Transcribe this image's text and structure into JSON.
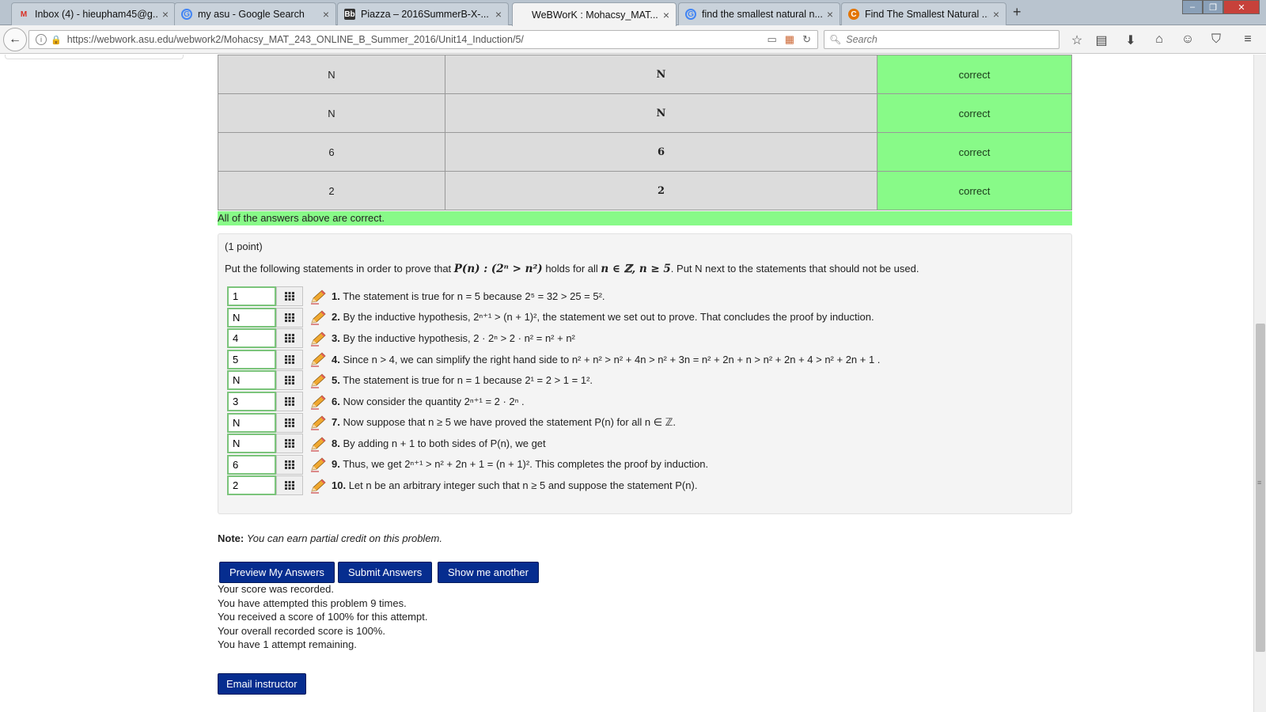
{
  "browser": {
    "tabs": [
      {
        "title": "Inbox (4) - hieupham45@g...",
        "icon": "gmail-icon"
      },
      {
        "title": "my asu - Google Search",
        "icon": "google-icon"
      },
      {
        "title": "Piazza – 2016SummerB-X-...",
        "icon": "blackboard-icon"
      },
      {
        "title": "WeBWorK : Mohacsy_MAT...",
        "icon": "webwork-icon"
      },
      {
        "title": "find the smallest natural n...",
        "icon": "google-icon"
      },
      {
        "title": "Find The Smallest Natural ...",
        "icon": "chegg-icon"
      }
    ],
    "url": "https://webwork.asu.edu/webwork2/Mohacsy_MAT_243_ONLINE_B_Summer_2016/Unit14_Induction/5/",
    "search_placeholder": "Search"
  },
  "attempt_results": {
    "rows": [
      {
        "entered": "N",
        "preview": "N",
        "result": "correct"
      },
      {
        "entered": "N",
        "preview": "N",
        "result": "correct"
      },
      {
        "entered": "6",
        "preview": "6",
        "result": "correct"
      },
      {
        "entered": "2",
        "preview": "2",
        "result": "correct"
      }
    ],
    "summary": "All of the answers above are correct."
  },
  "problem": {
    "points": "(1 point)",
    "instructions": {
      "lead": "Put the following statements in order to prove that ",
      "math1": "P(n) : (2ⁿ > n²)",
      "mid": " holds for all ",
      "math2": "n ∈ ℤ, n ≥ 5",
      "tail": ". Put N next to the statements that should not be used."
    },
    "statements": [
      {
        "answer": "1",
        "number": "1.",
        "text": "The statement is true for n = 5 because 2⁵ = 32 > 25 = 5²."
      },
      {
        "answer": "N",
        "number": "2.",
        "text": "By the inductive hypothesis, 2ⁿ⁺¹ > (n + 1)², the statement we set out to prove. That concludes the proof by induction."
      },
      {
        "answer": "4",
        "number": "3.",
        "text": "By the inductive hypothesis, 2 · 2ⁿ > 2 · n² = n² + n²"
      },
      {
        "answer": "5",
        "number": "4.",
        "text": "Since n > 4, we can simplify the right hand side to n² + n² > n² + 4n > n² + 3n = n² + 2n + n > n² + 2n + 4 > n² + 2n + 1 ."
      },
      {
        "answer": "N",
        "number": "5.",
        "text": "The statement is true for n = 1 because 2¹ = 2 > 1 = 1²."
      },
      {
        "answer": "3",
        "number": "6.",
        "text": "Now consider the quantity 2ⁿ⁺¹ = 2 · 2ⁿ ."
      },
      {
        "answer": "N",
        "number": "7.",
        "text": "Now suppose that n ≥ 5 we have proved the statement P(n) for all n ∈ ℤ."
      },
      {
        "answer": "N",
        "number": "8.",
        "text": "By adding n + 1 to both sides of P(n), we get"
      },
      {
        "answer": "6",
        "number": "9.",
        "text": "Thus, we get 2ⁿ⁺¹ > n² + 2n + 1 = (n + 1)². This completes the proof by induction."
      },
      {
        "answer": "2",
        "number": "10.",
        "text": "Let n be an arbitrary integer such that n ≥ 5 and suppose the statement P(n)."
      }
    ]
  },
  "note": {
    "label": "Note:",
    "text": "You can earn partial credit on this problem."
  },
  "buttons": {
    "preview": "Preview My Answers",
    "submit": "Submit Answers",
    "another": "Show me another",
    "email": "Email instructor"
  },
  "score_messages": [
    "Your score was recorded.",
    "You have attempted this problem 9 times.",
    "You received a score of 100% for this attempt.",
    "Your overall recorded score is 100%.",
    "You have 1 attempt remaining."
  ],
  "colors": {
    "correct_bg": "#88fa88",
    "button_bg": "#062d8f",
    "answer_border": "#7bc47b"
  }
}
